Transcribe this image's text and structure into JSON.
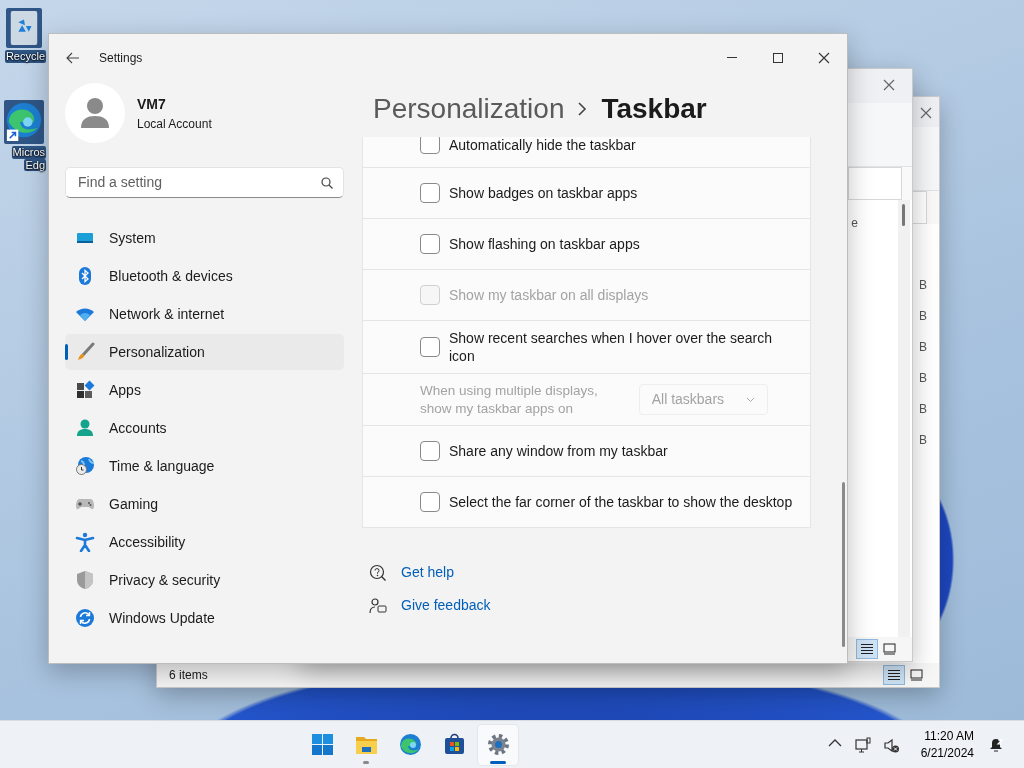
{
  "desktop": {
    "icons": [
      {
        "lines": [
          "Recycle"
        ]
      },
      {
        "lines": [
          "Micros",
          "Edg"
        ]
      }
    ]
  },
  "background_windows": [
    {
      "fragment_text": "e",
      "view_buttons": [
        {
          "selected": true
        },
        {
          "selected": false
        }
      ]
    },
    {
      "size_fragments": [
        "B",
        "B",
        "B",
        "B",
        "B",
        "B"
      ],
      "status": "6 items",
      "view_buttons": [
        {
          "selected": true
        },
        {
          "selected": false
        }
      ]
    }
  ],
  "settings": {
    "title": "Settings",
    "user": {
      "name": "VM7",
      "account": "Local Account"
    },
    "search": {
      "placeholder": "Find a setting"
    },
    "nav": [
      {
        "label": "System",
        "selected": false
      },
      {
        "label": "Bluetooth & devices",
        "selected": false
      },
      {
        "label": "Network & internet",
        "selected": false
      },
      {
        "label": "Personalization",
        "selected": true
      },
      {
        "label": "Apps",
        "selected": false
      },
      {
        "label": "Accounts",
        "selected": false
      },
      {
        "label": "Time & language",
        "selected": false
      },
      {
        "label": "Gaming",
        "selected": false
      },
      {
        "label": "Accessibility",
        "selected": false
      },
      {
        "label": "Privacy & security",
        "selected": false
      },
      {
        "label": "Windows Update",
        "selected": false
      }
    ],
    "breadcrumb": {
      "parent": "Personalization",
      "current": "Taskbar"
    },
    "options": [
      {
        "kind": "checkbox",
        "label": "Automatically hide the taskbar",
        "checked": false,
        "disabled": false
      },
      {
        "kind": "checkbox",
        "label": "Show badges on taskbar apps",
        "checked": false,
        "disabled": false
      },
      {
        "kind": "checkbox",
        "label": "Show flashing on taskbar apps",
        "checked": false,
        "disabled": false
      },
      {
        "kind": "checkbox",
        "label": "Show my taskbar on all displays",
        "checked": false,
        "disabled": true
      },
      {
        "kind": "checkbox",
        "label": "Show recent searches when I hover over the search icon",
        "checked": false,
        "disabled": false
      },
      {
        "kind": "dropdown",
        "label": "When using multiple displays, show my taskbar apps on",
        "value": "All taskbars",
        "disabled": true
      },
      {
        "kind": "checkbox",
        "label": "Share any window from my taskbar",
        "checked": false,
        "disabled": false
      },
      {
        "kind": "checkbox",
        "label": "Select the far corner of the taskbar to show the desktop",
        "checked": false,
        "disabled": false
      }
    ],
    "links": [
      {
        "label": "Get help"
      },
      {
        "label": "Give feedback"
      }
    ]
  },
  "taskbar": {
    "apps": [
      {
        "running": false,
        "active": false
      },
      {
        "running": true,
        "active": false
      },
      {
        "running": false,
        "active": false
      },
      {
        "running": false,
        "active": false
      },
      {
        "running": true,
        "active": true
      }
    ],
    "clock": {
      "time": "11:20 AM",
      "date": "6/21/2024"
    }
  }
}
